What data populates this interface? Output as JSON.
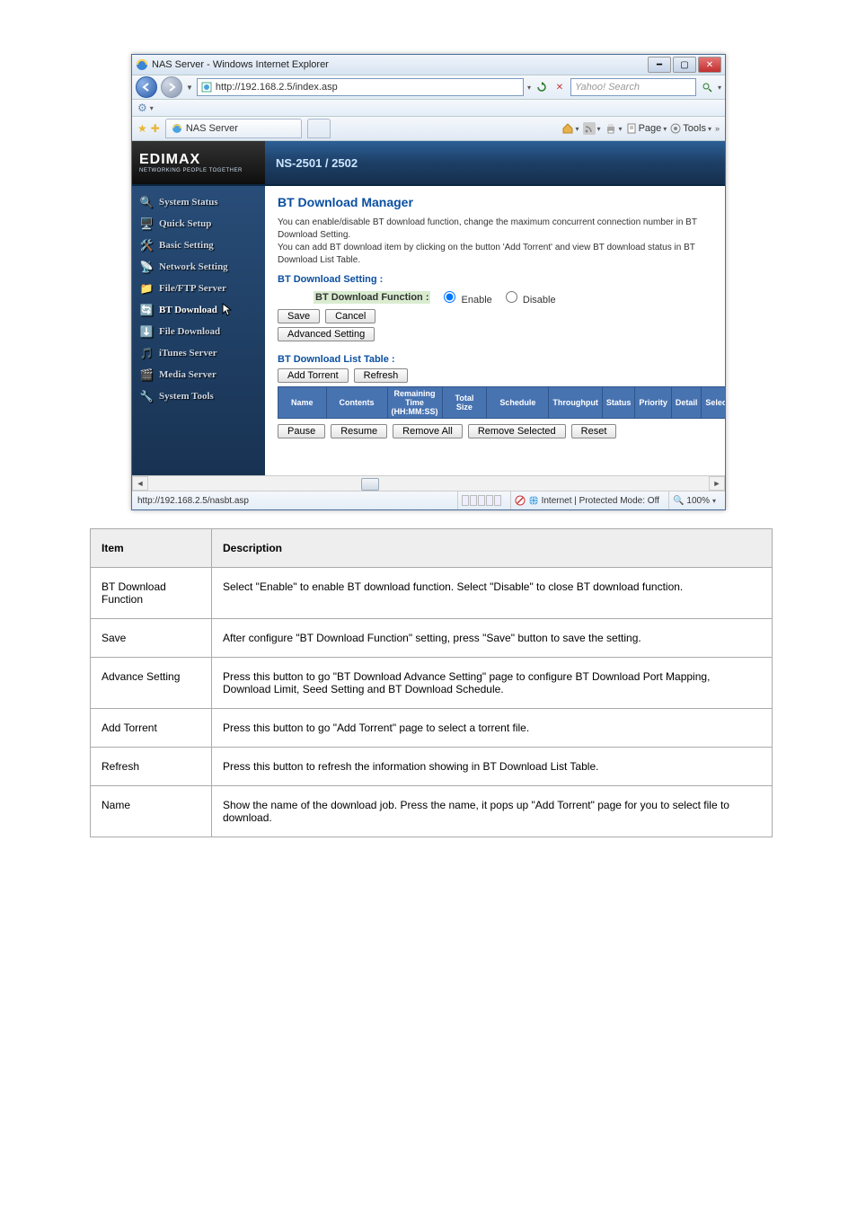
{
  "window": {
    "title": "NAS Server - Windows Internet Explorer",
    "url": "http://192.168.2.5/index.asp",
    "search_placeholder": "Yahoo! Search",
    "tab_label": "NAS Server",
    "toolbar": {
      "page": "Page",
      "tools": "Tools"
    }
  },
  "brand": {
    "logo": "EDIMAX",
    "tagline": "NETWORKING PEOPLE TOGETHER",
    "model": "NS-2501 / 2502"
  },
  "sidebar": {
    "items": [
      {
        "label": "System Status"
      },
      {
        "label": "Quick Setup"
      },
      {
        "label": "Basic Setting"
      },
      {
        "label": "Network Setting"
      },
      {
        "label": "File/FTP Server"
      },
      {
        "label": "BT Download"
      },
      {
        "label": "File Download"
      },
      {
        "label": "iTunes Server"
      },
      {
        "label": "Media Server"
      },
      {
        "label": "System Tools"
      }
    ]
  },
  "main": {
    "title": "BT Download Manager",
    "desc1": "You can enable/disable BT download function, change the maximum concurrent connection number in BT Download Setting.",
    "desc2": "You can add BT download item by clicking on the button 'Add Torrent' and view BT download status in BT Download List Table.",
    "setting_head": "BT Download Setting :",
    "func_label": "BT Download Function :",
    "enable": "Enable",
    "disable": "Disable",
    "save": "Save",
    "cancel": "Cancel",
    "advanced": "Advanced Setting",
    "list_head": "BT Download List Table :",
    "add_torrent": "Add Torrent",
    "refresh": "Refresh",
    "columns": {
      "name": "Name",
      "contents": "Contents",
      "remaining": "Remaining Time (HH:MM:SS)",
      "total": "Total Size",
      "schedule": "Schedule",
      "throughput": "Throughput",
      "status": "Status",
      "priority": "Priority",
      "detail": "Detail",
      "select": "Select"
    },
    "pause": "Pause",
    "resume": "Resume",
    "remove_all": "Remove All",
    "remove_selected": "Remove Selected",
    "reset": "Reset"
  },
  "status": {
    "url": "http://192.168.2.5/nasbt.asp",
    "zone": "Internet | Protected Mode: Off",
    "zoom": "100%"
  },
  "table": {
    "header_item": "Item",
    "header_desc": "Description",
    "rows": [
      {
        "item": "BT Download Function",
        "desc": "Select \"Enable\" to enable BT download function. Select \"Disable\" to close BT download function."
      },
      {
        "item": "Save",
        "desc": "After configure \"BT Download Function\" setting, press \"Save\" button to save the setting."
      },
      {
        "item": "Advance Setting",
        "desc": "Press this button to go \"BT Download Advance Setting\" page to configure BT Download Port Mapping, Download Limit, Seed Setting and BT Download Schedule."
      },
      {
        "item": "Add Torrent",
        "desc": "Press this button to go \"Add Torrent\" page to select a torrent file."
      },
      {
        "item": "Refresh",
        "desc": "Press this button to refresh the information showing in BT Download List Table."
      },
      {
        "item": "Name",
        "desc": "Show the name of the download job. Press the name, it pops up \"Add Torrent\" page for you to select file to download."
      }
    ]
  }
}
